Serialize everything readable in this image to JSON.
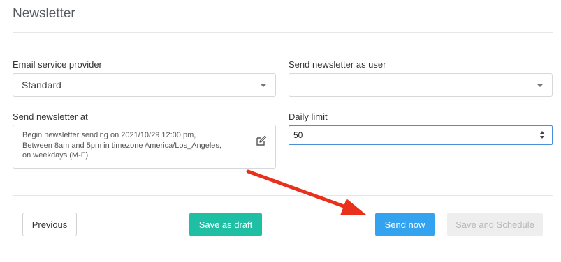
{
  "page": {
    "title": "Newsletter"
  },
  "form": {
    "provider": {
      "label": "Email service provider",
      "value": "Standard"
    },
    "send_as": {
      "label": "Send newsletter as user",
      "value": ""
    },
    "send_at": {
      "label": "Send newsletter at",
      "lines": [
        "Begin newsletter sending on 2021/10/29 12:00 pm,",
        "Between 8am and 5pm in timezone America/Los_Angeles,",
        "on weekdays (M-F)"
      ]
    },
    "daily_limit": {
      "label": "Daily limit",
      "value": "50"
    }
  },
  "buttons": {
    "previous": "Previous",
    "save_draft": "Save as draft",
    "send_now": "Send now",
    "save_schedule": "Save and Schedule"
  },
  "colors": {
    "send_now": "#33a3f0",
    "save_draft": "#1fbfa4",
    "annotation_arrow": "#e8301c",
    "disabled": "#eeeeee"
  },
  "icons": [
    "edit-icon",
    "chevron-down-icon",
    "spinner-icon",
    "arrow-annotation"
  ]
}
